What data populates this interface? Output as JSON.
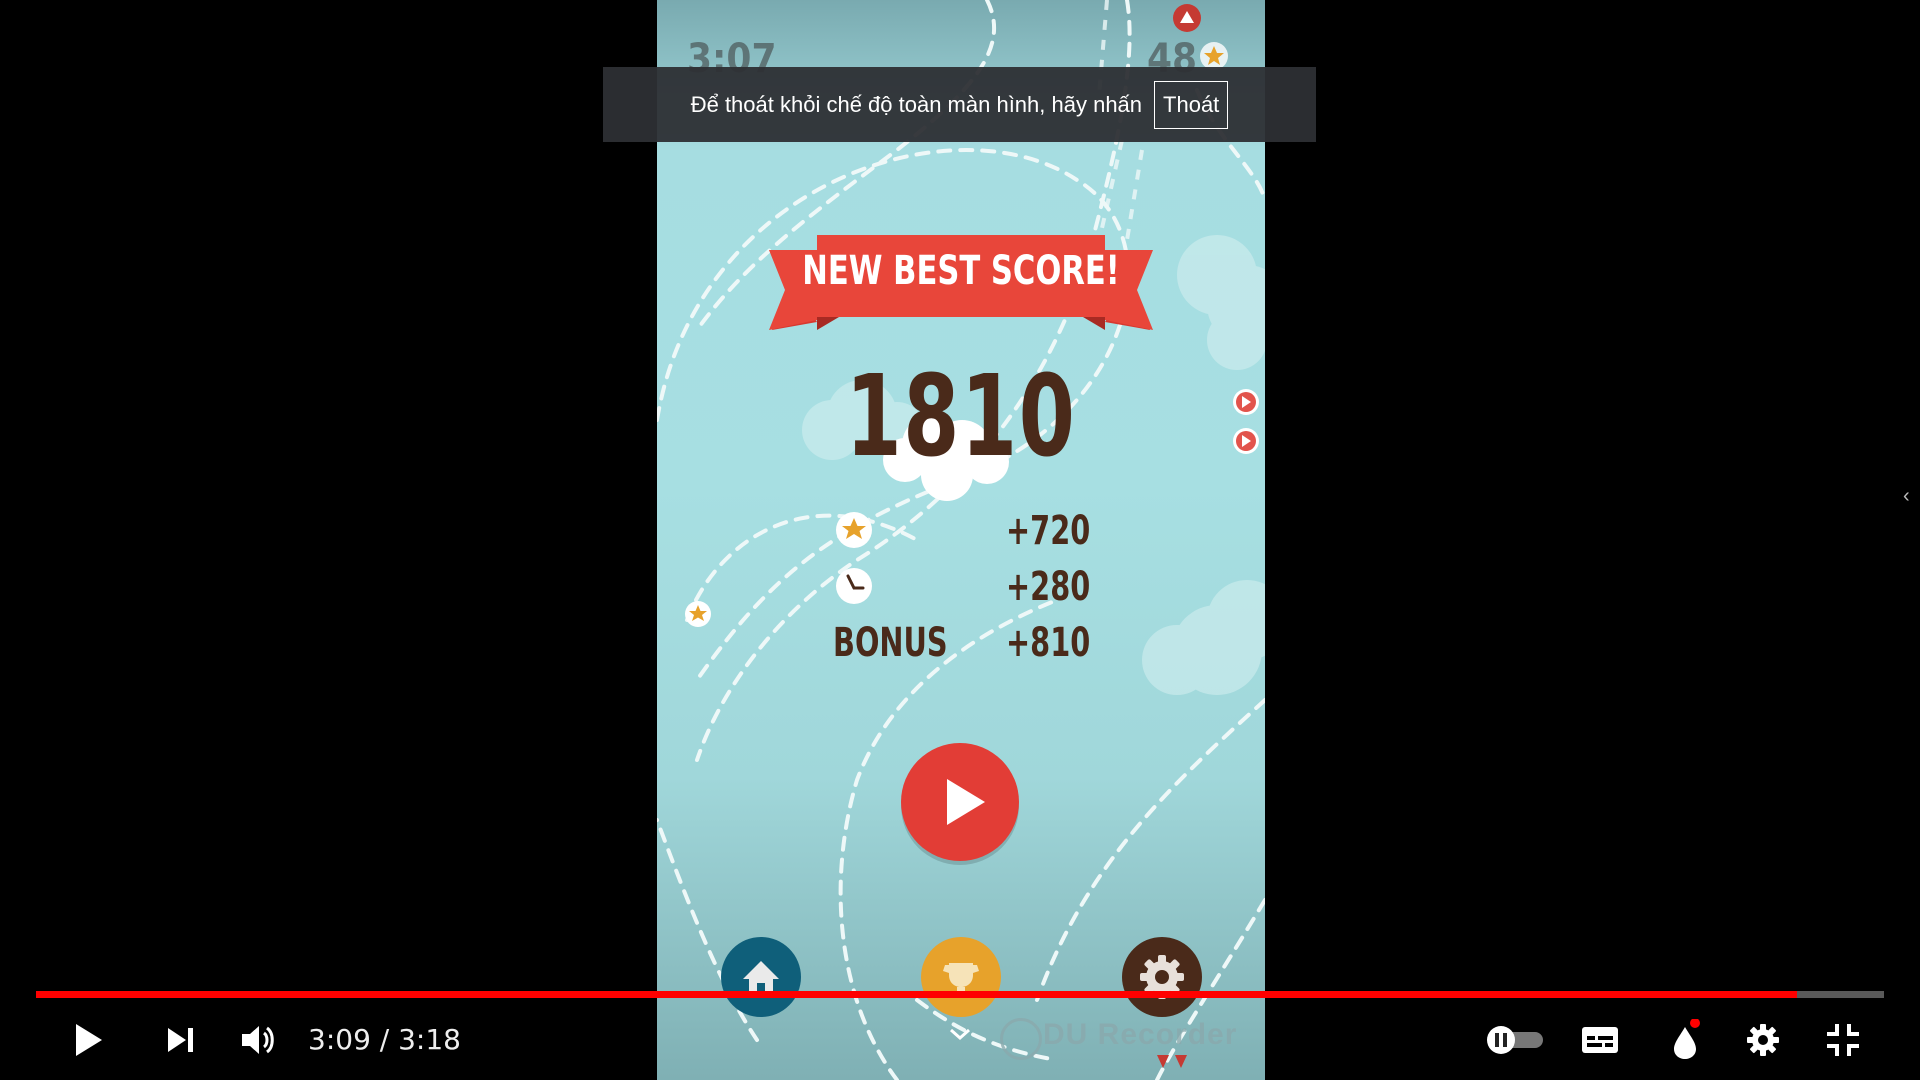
{
  "game": {
    "hud_time": "3:07",
    "hud_stars": "48",
    "banner": "NEW BEST SCORE!",
    "score": "1810",
    "rows": [
      {
        "label": "",
        "icon": "star-icon",
        "value": "+720"
      },
      {
        "label": "",
        "icon": "clock-icon",
        "value": "+280"
      },
      {
        "label": "BONUS",
        "icon": "",
        "value": "+810"
      }
    ],
    "watermark": "DU Recorder",
    "colors": {
      "banner": "#e8463a",
      "play": "#e23d36",
      "home": "#0f5f7a",
      "trophy": "#e7a22b",
      "settings": "#4a2a1a",
      "sky": "#a6dde1"
    }
  },
  "toast": {
    "message": "Để thoát khỏi chế độ toàn màn hình, hãy nhấn",
    "button": "Thoát"
  },
  "player": {
    "time_display": "3:09 / 3:18",
    "progress": 0.953,
    "buffered": 1.0,
    "autoplay": "paused",
    "icons": [
      "play-icon",
      "next-icon",
      "volume-icon",
      "autoplay-toggle-icon",
      "subtitles-icon",
      "ambient-mode-icon",
      "settings-icon",
      "exit-fullscreen-icon",
      "chevron-down-icon",
      "chevron-left-icon"
    ]
  }
}
